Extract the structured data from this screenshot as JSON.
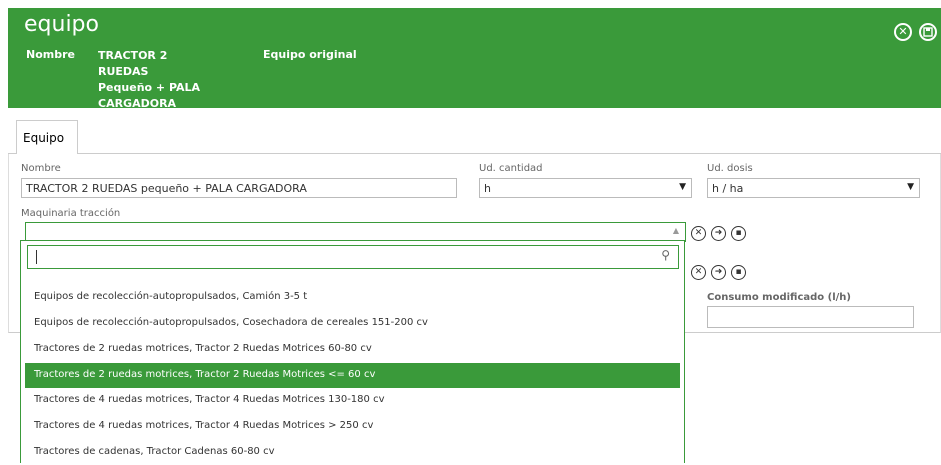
{
  "header": {
    "title": "equipo",
    "nombre_label": "Nombre",
    "nombre_value_1": "TRACTOR 2 RUEDAS",
    "nombre_value_2": "Pequeño + PALA",
    "nombre_value_3": "CARGADORA",
    "original_label": "Equipo original",
    "close_icon": "⊗",
    "save_icon": "save-icon"
  },
  "tabs": [
    {
      "label": "Equipo"
    }
  ],
  "form": {
    "nombre_label": "Nombre",
    "nombre_value": "TRACTOR 2 RUEDAS pequeño + PALA CARGADORA",
    "ud_cantidad_label": "Ud. cantidad",
    "ud_cantidad_value": "h",
    "ud_dosis_label": "Ud. dosis",
    "ud_dosis_value": "h / ha",
    "maquinaria_label": "Maquinaria tracción",
    "consumo_label": "Consumo modificado (l/h)",
    "consumo_value": ""
  },
  "dropdown": {
    "search_value": "",
    "options": [
      "Equipos de recolección-autopropulsados, Camión 3-5 t",
      "Equipos de recolección-autopropulsados, Cosechadora de cereales 151-200 cv",
      "Tractores de 2 ruedas motrices, Tractor 2 Ruedas Motrices 60-80 cv",
      "Tractores de 2 ruedas motrices, Tractor 2 Ruedas Motrices <= 60 cv",
      "Tractores de 4 ruedas motrices, Tractor 4 Ruedas Motrices 130-180 cv",
      "Tractores de 4 ruedas motrices, Tractor 4 Ruedas Motrices > 250 cv",
      "Tractores de cadenas, Tractor Cadenas 60-80 cv"
    ],
    "selected_index": 3
  },
  "colors": {
    "accent": "#3a9a3a"
  }
}
